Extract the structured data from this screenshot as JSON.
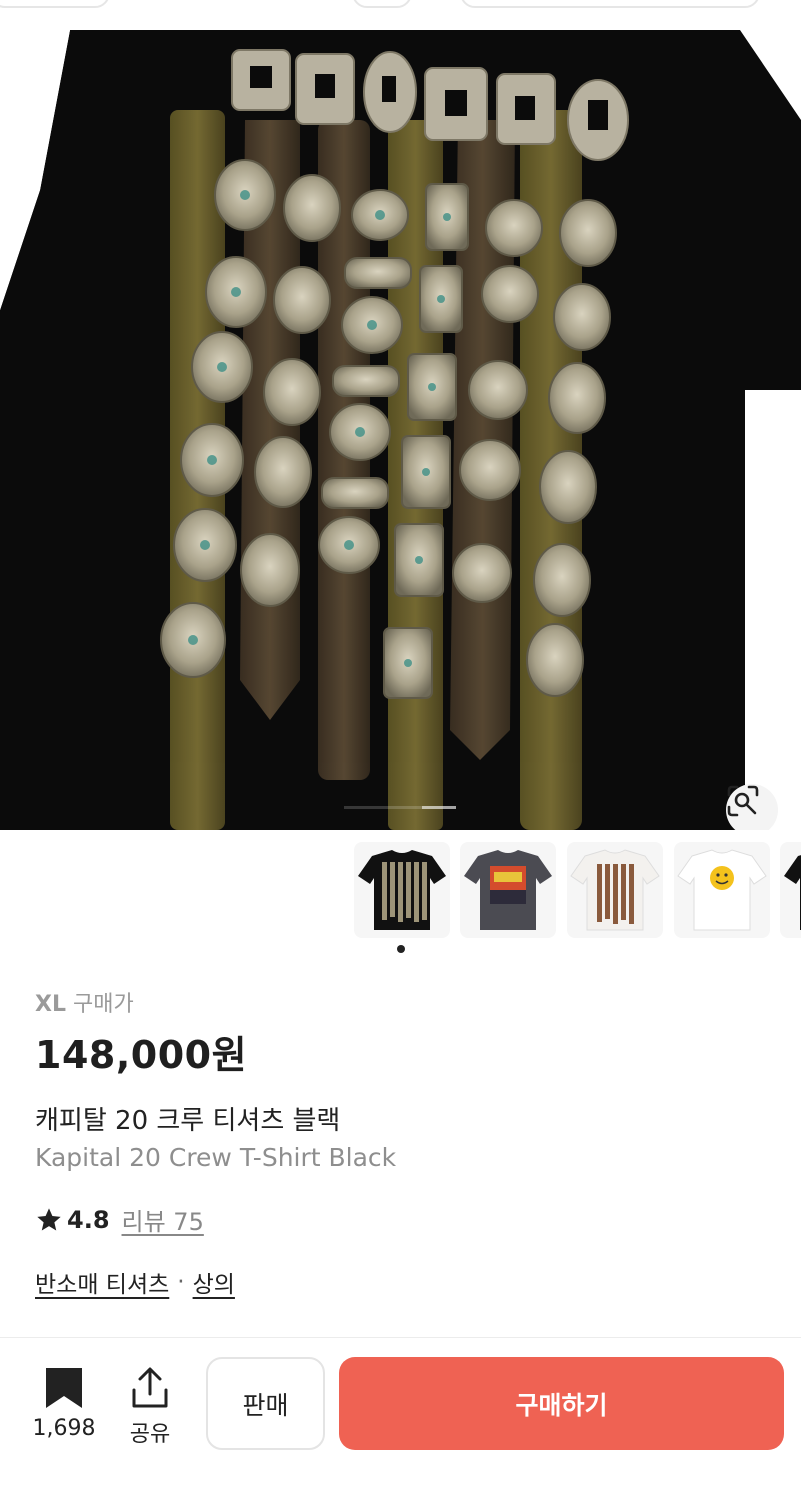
{
  "colors": {
    "accent": "#ef6253",
    "price": "#1f1f1f",
    "muted": "#8e8e8e",
    "shirt_black": "#0b0b0b"
  },
  "hero": {
    "image": "kapital-concho-belt-print-tee",
    "lens_icon": "image-search-icon"
  },
  "thumbnails": [
    {
      "name": "black-tee-belts"
    },
    {
      "name": "grey-tee-print"
    },
    {
      "name": "white-tee-belts"
    },
    {
      "name": "white-tee-smiley"
    }
  ],
  "product": {
    "size": "XL",
    "price_label": "구매가",
    "price": "148,000원",
    "name_ko": "캐피탈 20 크루 티셔츠 블랙",
    "name_en": "Kapital 20 Crew T-Shirt Black",
    "rating": "4.8",
    "review_label": "리뷰 75",
    "category_1": "반소매 티셔츠",
    "category_sep": "·",
    "category_2": "상의"
  },
  "actions": {
    "bookmark_count": "1,698",
    "share_label": "공유",
    "sell_label": "판매",
    "buy_label": "구매하기"
  }
}
